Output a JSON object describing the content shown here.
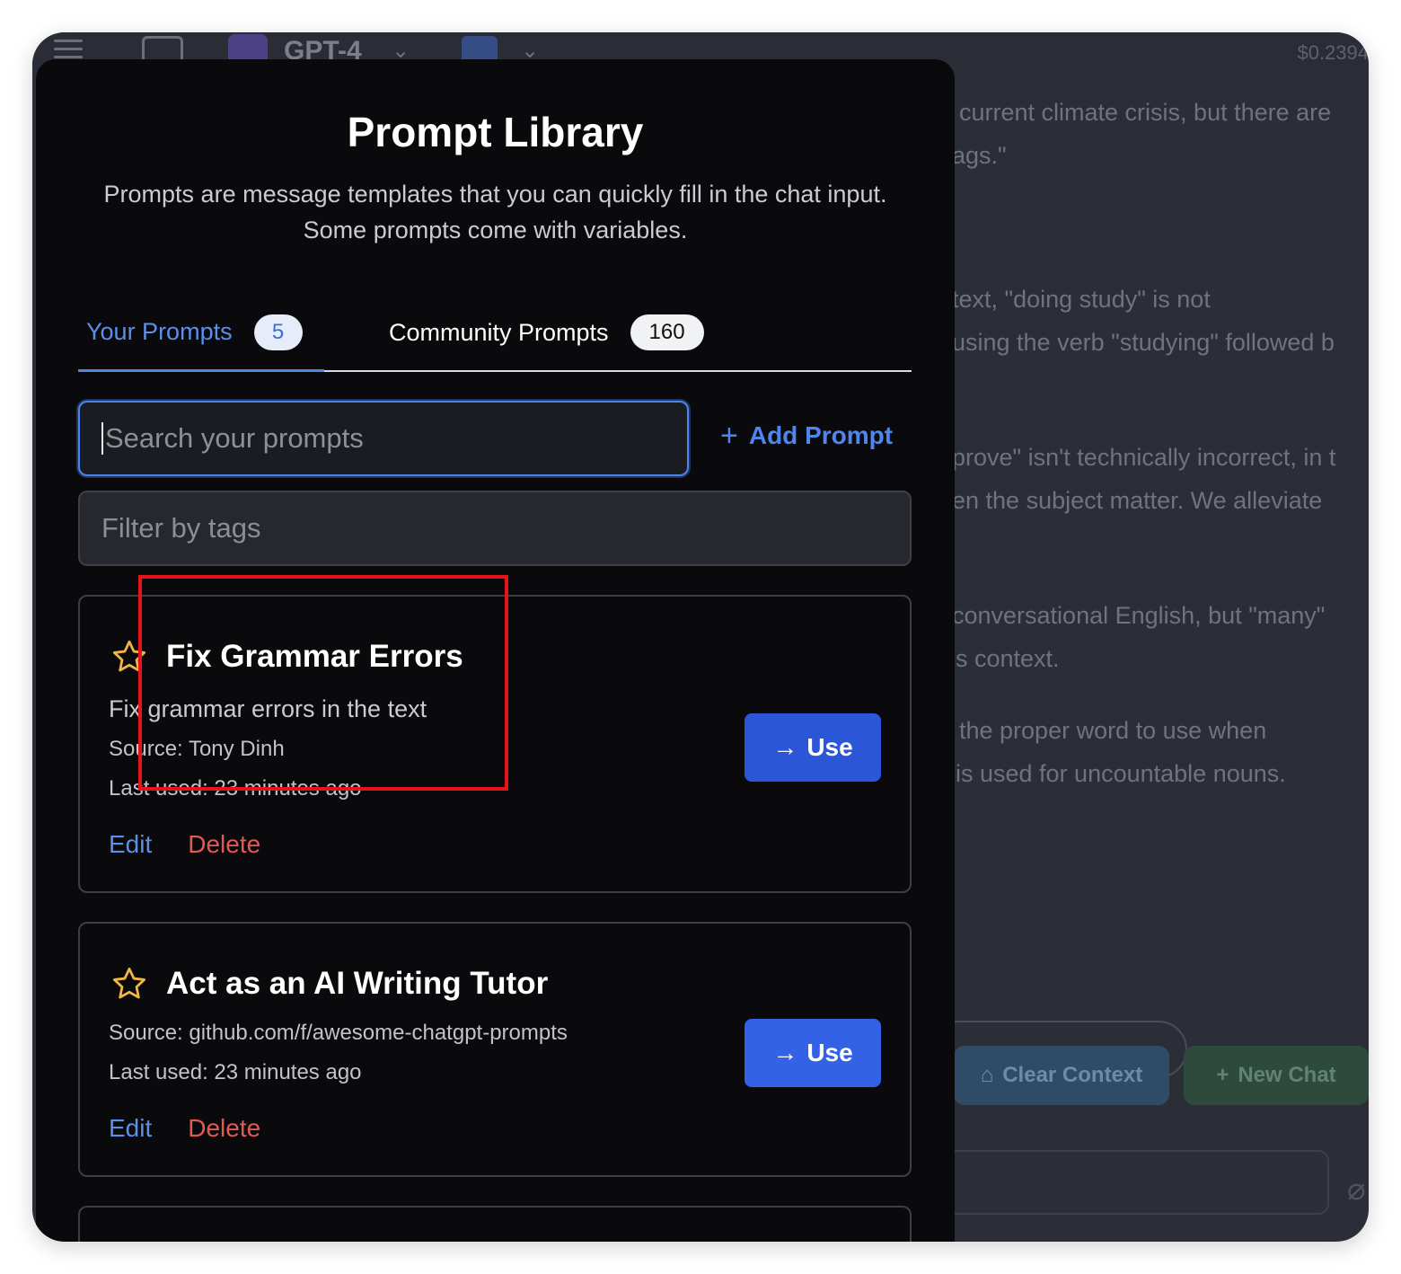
{
  "background_app": {
    "model_name": "GPT-4",
    "cost": "$0.2394",
    "chat_fragments": [
      "current climate crisis, but there are",
      "ags.\"",
      "text, \"doing study\" is not",
      "using the verb \"studying\" followed b",
      "prove\" isn't technically incorrect, in t",
      "en the subject matter. We alleviate",
      "conversational English, but \"many\"",
      "s context.",
      "the proper word to use when",
      "is used for uncountable nouns."
    ],
    "clear_context_label": "Clear Context",
    "new_chat_label": "New Chat"
  },
  "modal": {
    "title": "Prompt Library",
    "description": "Prompts are message templates that you can quickly fill in the chat input. Some prompts come with variables.",
    "tabs": [
      {
        "label": "Your Prompts",
        "count": "5",
        "active": true
      },
      {
        "label": "Community Prompts",
        "count": "160",
        "active": false
      }
    ],
    "search": {
      "placeholder": "Search your prompts",
      "value": ""
    },
    "add_prompt_label": "Add Prompt",
    "filter": {
      "placeholder": "Filter by tags",
      "value": ""
    },
    "prompts": [
      {
        "title": "Fix Grammar Errors",
        "description": "Fix grammar errors in the text",
        "source": "Source: Tony Dinh",
        "last_used": "Last used: 23 minutes ago",
        "use_label": "Use",
        "edit_label": "Edit",
        "delete_label": "Delete"
      },
      {
        "title": "Act as an AI Writing Tutor",
        "source": "Source: github.com/f/awesome-chatgpt-prompts",
        "last_used": "Last used: 23 minutes ago",
        "use_label": "Use",
        "edit_label": "Edit",
        "delete_label": "Delete"
      }
    ]
  },
  "colors": {
    "accent": "#4f86ee",
    "use_button": "#2b56d8",
    "delete": "#e05a52",
    "star": "#f2b544",
    "highlight_box": "#e8121a"
  }
}
